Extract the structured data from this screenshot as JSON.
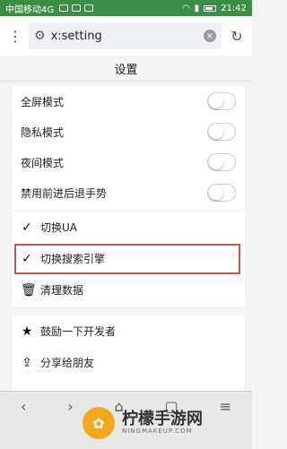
{
  "status_bar": {
    "carrier": "中国移动4G",
    "time": "21:42"
  },
  "address_bar": {
    "url": "x:setting",
    "clear_icon": "close-circle-icon",
    "refresh_icon": "refresh-icon",
    "menu_icon": "more-vert-icon",
    "gear_icon": "gear-icon"
  },
  "title": "设置",
  "toggles": [
    {
      "label": "全屏模式",
      "on": false
    },
    {
      "label": "隐私模式",
      "on": false
    },
    {
      "label": "夜间模式",
      "on": false
    },
    {
      "label": "禁用前进后退手势",
      "on": false
    }
  ],
  "actions": [
    {
      "label": "切换UA",
      "icon": "check-icon",
      "glyph": "✓"
    },
    {
      "label": "切换搜索引擎",
      "icon": "check-icon",
      "glyph": "✓"
    },
    {
      "label": "清理数据",
      "icon": "trash-icon",
      "glyph": "🗑"
    }
  ],
  "extra": [
    {
      "label": "鼓励一下开发者",
      "icon": "star-icon",
      "glyph": "★"
    },
    {
      "label": "分享给朋友",
      "icon": "share-icon",
      "glyph": "⇪"
    }
  ],
  "watermark": {
    "logo_glyph": "✿",
    "title": "柠檬手游网",
    "subtitle": "NINGMAKEUP.COM"
  },
  "colors": {
    "status_bar": "#3a8f45",
    "highlight_border": "#d05050"
  }
}
